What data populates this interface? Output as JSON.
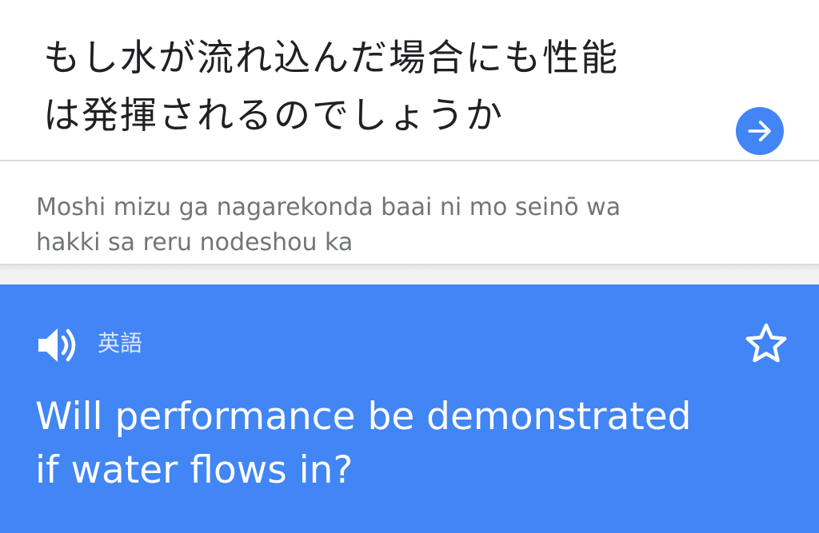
{
  "source": {
    "text": "もし水が流れ込んだ場合にも性能\nは発揮されるのでしょうか",
    "submit_icon": "arrow-right-circle-icon"
  },
  "romanization": {
    "text": "Moshi mizu ga nagarekonda baai ni mo seinō wa\nhakki sa reru nodeshou ka"
  },
  "result": {
    "language_label": "英語",
    "speaker_icon": "speaker-icon",
    "favorite_icon": "star-outline-icon",
    "translation": "Will performance be demonstrated\nif water flows in?"
  },
  "colors": {
    "accent": "#4285f4",
    "source_text": "#202124",
    "romanization_text": "#70757a",
    "result_text": "#ffffff"
  }
}
